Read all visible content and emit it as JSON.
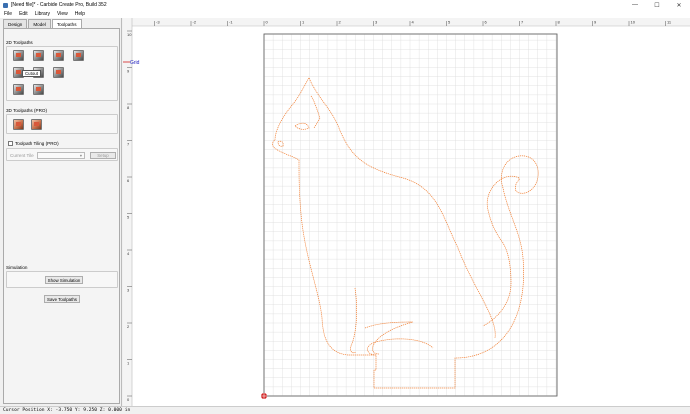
{
  "window": {
    "title": "[Need file]* - Carbide Create Pro, Build 352",
    "minimize": "—",
    "maximize": "☐",
    "close": "✕"
  },
  "menu": [
    "File",
    "Edit",
    "Library",
    "View",
    "Help"
  ],
  "tabs": [
    {
      "label": "Design",
      "active": false
    },
    {
      "label": "Model",
      "active": false
    },
    {
      "label": "Toolpaths",
      "active": true
    }
  ],
  "toolpaths_2d": {
    "label": "2D Toolpaths",
    "tooltip": "Cutout"
  },
  "toolpaths_3d": {
    "label": "3D Toolpaths (PRO)"
  },
  "tiling": {
    "label": "Toolpath Tiling (PRO)",
    "checked": false,
    "current_tile_label": "Current Tile",
    "setup_label": "Setup"
  },
  "simulation": {
    "label": "Simulation",
    "show_button": "Show Simulation"
  },
  "save_button": "Save Toolpaths",
  "canvas": {
    "grid_label": "Grid",
    "x_ticks": [
      "-3",
      "-2",
      "-1",
      "0",
      "1",
      "2",
      "3",
      "4",
      "5",
      "6",
      "7",
      "8",
      "9",
      "10",
      "11"
    ],
    "y_ticks": [
      "10",
      "9",
      "8",
      "7",
      "6",
      "5",
      "4",
      "3",
      "2",
      "1",
      "0"
    ],
    "toolpath_color": "#f07828",
    "stock_color": "#ffffff",
    "grid_color": "#dcdcdc"
  },
  "status": {
    "text": "Cursor Position X: -3.750 Y: 9.250 Z: 0.000 in"
  }
}
